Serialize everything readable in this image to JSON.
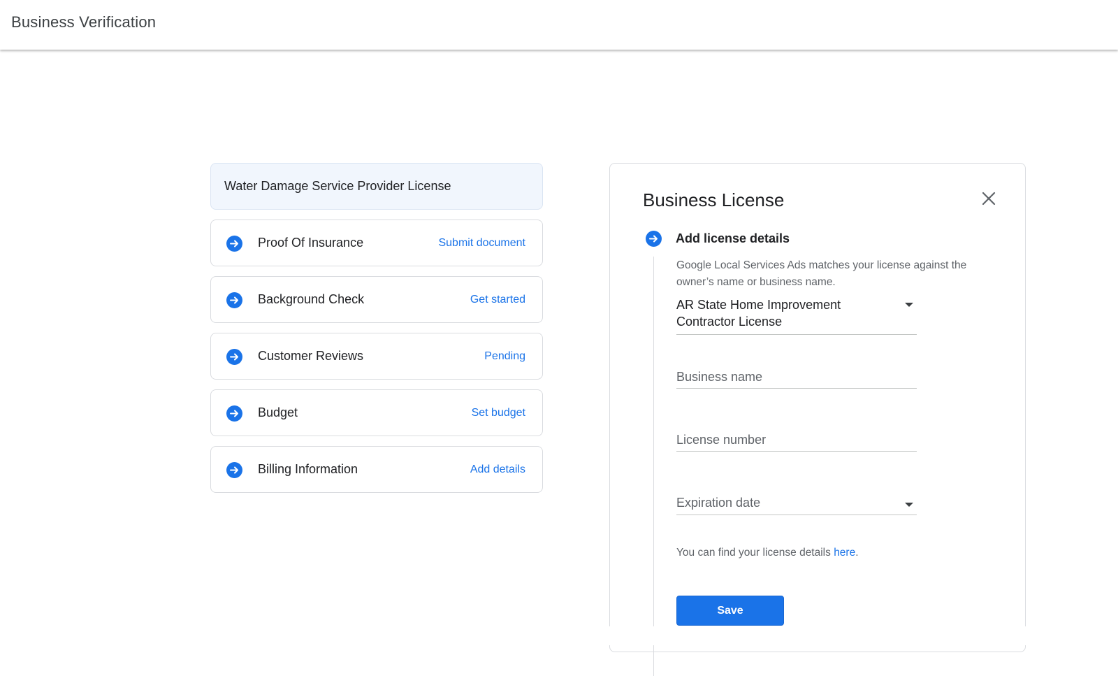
{
  "app": {
    "title": "Business Verification"
  },
  "checklist": {
    "header": "Water Damage Service Provider License",
    "steps": [
      {
        "label": "Proof Of Insurance",
        "action": "Submit document",
        "icon": "arrow-right-circle-icon"
      },
      {
        "label": "Background Check",
        "action": "Get started",
        "icon": "arrow-right-circle-icon"
      },
      {
        "label": "Customer Reviews",
        "action": "Pending",
        "icon": "arrow-right-circle-icon"
      },
      {
        "label": "Budget",
        "action": "Set budget",
        "icon": "arrow-right-circle-icon"
      },
      {
        "label": "Billing Information",
        "action": "Add details",
        "icon": "arrow-right-circle-icon"
      }
    ]
  },
  "panel": {
    "title": "Business License",
    "close_icon": "close-icon",
    "section_title": "Add license details",
    "description": "Google Local Services Ads matches your license against the owner’s name or business name.",
    "license_type": "AR State Home Improvement Contractor License",
    "business_name_placeholder": "Business name",
    "license_number_placeholder": "License number",
    "expiration_placeholder": "Expiration date",
    "hint_text": "You can find your license details ",
    "hint_link": "here",
    "hint_end": ".",
    "save_label": "Save"
  },
  "colors": {
    "accent": "#1a73e8",
    "header_bg": "#f1f6fd",
    "border": "#dadce0"
  }
}
